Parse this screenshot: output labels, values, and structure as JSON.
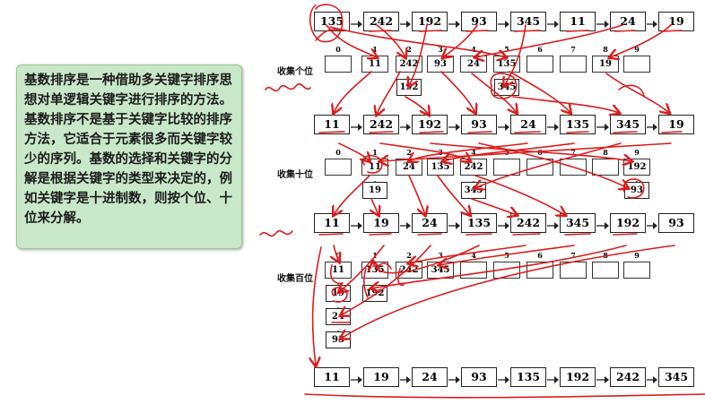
{
  "description_box": {
    "text": "基数排序是一种借助多关键字排序思想对单逻辑关键字进行排序的方法。基数排序不是基于关键字比较的排序方法，它适合于元素很多而关键字较少的序列。基数的选择和关键字的分解是根据关键字的类型来决定的，例如关键字是十进制数，则按个位、十位来分解。"
  },
  "row_labels": {
    "ones": "收集个位",
    "tens": "收集十位",
    "hundreds": "收集百位"
  },
  "bucket_indices": [
    "0",
    "1",
    "2",
    "3",
    "4",
    "5",
    "6",
    "7",
    "8",
    "9"
  ],
  "lists": {
    "initial": [
      "135",
      "242",
      "192",
      "93",
      "345",
      "11",
      "24",
      "19"
    ],
    "after_ones": [
      "11",
      "242",
      "192",
      "93",
      "24",
      "135",
      "345",
      "19"
    ],
    "after_tens": [
      "11",
      "19",
      "24",
      "135",
      "242",
      "345",
      "192",
      "93"
    ],
    "final": [
      "11",
      "19",
      "24",
      "93",
      "135",
      "192",
      "242",
      "345"
    ]
  },
  "buckets": {
    "ones": [
      [],
      [
        "11"
      ],
      [
        "242",
        "192"
      ],
      [
        "93"
      ],
      [
        "24"
      ],
      [
        "135",
        "345"
      ],
      [],
      [],
      [
        "19"
      ],
      []
    ],
    "tens": [
      [],
      [
        "11",
        "19"
      ],
      [
        "24"
      ],
      [
        "135"
      ],
      [
        "242",
        "345"
      ],
      [],
      [],
      [],
      [],
      [
        "192",
        "93"
      ]
    ],
    "hundreds": [
      [
        "11",
        "19",
        "24",
        "93"
      ],
      [
        "135",
        "192"
      ],
      [
        "242"
      ],
      [
        "345"
      ],
      [],
      [],
      [],
      [],
      [],
      []
    ]
  },
  "colors": {
    "annotation_red": "#dd1c1c",
    "note_bg": "#c9e8c9"
  }
}
